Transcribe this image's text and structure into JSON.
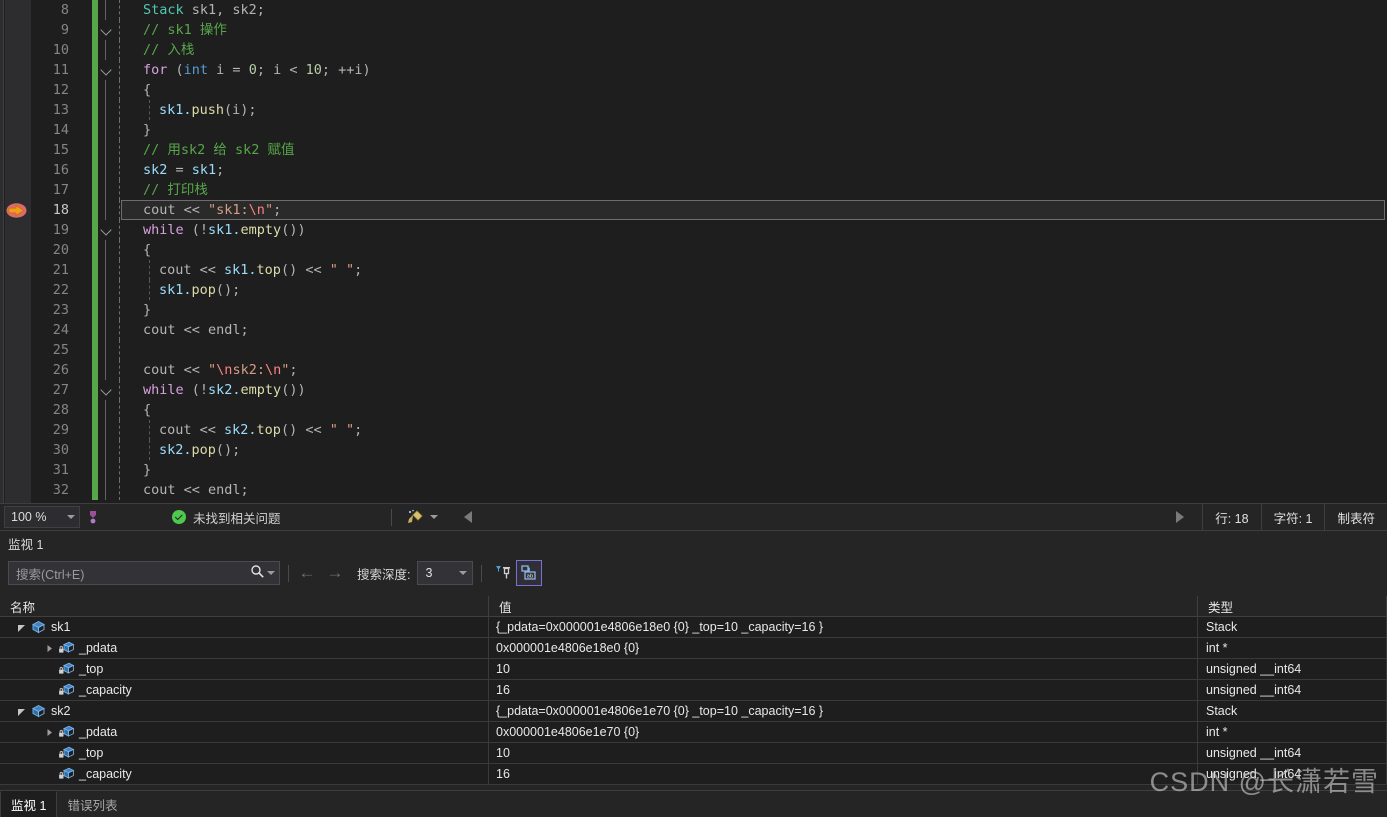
{
  "editor": {
    "lines": [
      {
        "n": "8",
        "chev": false,
        "guide": false,
        "indent": 2,
        "tokens": [
          {
            "t": "Stack",
            "c": "typ"
          },
          {
            "t": " sk1, sk2;",
            "c": "pun"
          }
        ]
      },
      {
        "n": "9",
        "chev": true,
        "guide": false,
        "indent": 2,
        "tokens": [
          {
            "t": "// sk1 操作",
            "c": "cmt"
          }
        ]
      },
      {
        "n": "10",
        "chev": false,
        "guide": false,
        "indent": 2,
        "tokens": [
          {
            "t": "// 入栈",
            "c": "cmt"
          }
        ]
      },
      {
        "n": "11",
        "chev": true,
        "guide": false,
        "indent": 2,
        "tokens": [
          {
            "t": "for",
            "c": "kw"
          },
          {
            "t": " (",
            "c": "pun"
          },
          {
            "t": "int",
            "c": "bt"
          },
          {
            "t": " i = ",
            "c": "pun"
          },
          {
            "t": "0",
            "c": "num"
          },
          {
            "t": "; i < ",
            "c": "pun"
          },
          {
            "t": "10",
            "c": "num"
          },
          {
            "t": "; ++i)",
            "c": "pun"
          }
        ]
      },
      {
        "n": "12",
        "chev": false,
        "guide": false,
        "indent": 2,
        "tokens": [
          {
            "t": "{",
            "c": "pun"
          }
        ]
      },
      {
        "n": "13",
        "chev": false,
        "guide": true,
        "indent": 4,
        "tokens": [
          {
            "t": "sk1.",
            "c": "var"
          },
          {
            "t": "push",
            "c": "fn"
          },
          {
            "t": "(i);",
            "c": "pun"
          }
        ]
      },
      {
        "n": "14",
        "chev": false,
        "guide": false,
        "indent": 2,
        "tokens": [
          {
            "t": "}",
            "c": "pun"
          }
        ]
      },
      {
        "n": "15",
        "chev": false,
        "guide": false,
        "indent": 2,
        "tokens": [
          {
            "t": "// 用sk2 给 sk2 赋值",
            "c": "cmt"
          }
        ]
      },
      {
        "n": "16",
        "chev": false,
        "guide": false,
        "indent": 2,
        "tokens": [
          {
            "t": "sk2",
            "c": "var"
          },
          {
            "t": " = ",
            "c": "pun"
          },
          {
            "t": "sk1",
            "c": "var"
          },
          {
            "t": ";",
            "c": "pun"
          }
        ]
      },
      {
        "n": "17",
        "chev": false,
        "guide": false,
        "indent": 2,
        "tokens": [
          {
            "t": "// 打印栈",
            "c": "cmt"
          }
        ]
      },
      {
        "n": "18",
        "chev": false,
        "guide": false,
        "indent": 2,
        "current": true,
        "tokens": [
          {
            "t": "cout",
            "c": "pun"
          },
          {
            "t": " << ",
            "c": "op"
          },
          {
            "t": "\"sk1:",
            "c": "str"
          },
          {
            "t": "\\n",
            "c": "esc"
          },
          {
            "t": "\"",
            "c": "str"
          },
          {
            "t": ";",
            "c": "pun"
          }
        ]
      },
      {
        "n": "19",
        "chev": true,
        "guide": false,
        "indent": 2,
        "tokens": [
          {
            "t": "while",
            "c": "kw"
          },
          {
            "t": " (!",
            "c": "pun"
          },
          {
            "t": "sk1.",
            "c": "var"
          },
          {
            "t": "empty",
            "c": "fn"
          },
          {
            "t": "())",
            "c": "pun"
          }
        ]
      },
      {
        "n": "20",
        "chev": false,
        "guide": false,
        "indent": 2,
        "tokens": [
          {
            "t": "{",
            "c": "pun"
          }
        ]
      },
      {
        "n": "21",
        "chev": false,
        "guide": true,
        "indent": 4,
        "tokens": [
          {
            "t": "cout",
            "c": "pun"
          },
          {
            "t": " << ",
            "c": "op"
          },
          {
            "t": "sk1.",
            "c": "var"
          },
          {
            "t": "top",
            "c": "fn"
          },
          {
            "t": "()",
            "c": "pun"
          },
          {
            "t": " << ",
            "c": "op"
          },
          {
            "t": "\" \"",
            "c": "str"
          },
          {
            "t": ";",
            "c": "pun"
          }
        ]
      },
      {
        "n": "22",
        "chev": false,
        "guide": true,
        "indent": 4,
        "tokens": [
          {
            "t": "sk1.",
            "c": "var"
          },
          {
            "t": "pop",
            "c": "fn"
          },
          {
            "t": "();",
            "c": "pun"
          }
        ]
      },
      {
        "n": "23",
        "chev": false,
        "guide": false,
        "indent": 2,
        "tokens": [
          {
            "t": "}",
            "c": "pun"
          }
        ]
      },
      {
        "n": "24",
        "chev": false,
        "guide": false,
        "indent": 2,
        "tokens": [
          {
            "t": "cout",
            "c": "pun"
          },
          {
            "t": " << ",
            "c": "op"
          },
          {
            "t": "endl",
            "c": "pun"
          },
          {
            "t": ";",
            "c": "pun"
          }
        ]
      },
      {
        "n": "25",
        "chev": false,
        "guide": false,
        "indent": 2,
        "tokens": []
      },
      {
        "n": "26",
        "chev": false,
        "guide": false,
        "indent": 2,
        "tokens": [
          {
            "t": "cout",
            "c": "pun"
          },
          {
            "t": " << ",
            "c": "op"
          },
          {
            "t": "\"",
            "c": "str"
          },
          {
            "t": "\\n",
            "c": "esc"
          },
          {
            "t": "sk2:",
            "c": "str"
          },
          {
            "t": "\\n",
            "c": "esc"
          },
          {
            "t": "\"",
            "c": "str"
          },
          {
            "t": ";",
            "c": "pun"
          }
        ]
      },
      {
        "n": "27",
        "chev": true,
        "guide": false,
        "indent": 2,
        "tokens": [
          {
            "t": "while",
            "c": "kw"
          },
          {
            "t": " (!",
            "c": "pun"
          },
          {
            "t": "sk2.",
            "c": "var"
          },
          {
            "t": "empty",
            "c": "fn"
          },
          {
            "t": "())",
            "c": "pun"
          }
        ]
      },
      {
        "n": "28",
        "chev": false,
        "guide": false,
        "indent": 2,
        "tokens": [
          {
            "t": "{",
            "c": "pun"
          }
        ]
      },
      {
        "n": "29",
        "chev": false,
        "guide": true,
        "indent": 4,
        "tokens": [
          {
            "t": "cout",
            "c": "pun"
          },
          {
            "t": " << ",
            "c": "op"
          },
          {
            "t": "sk2.",
            "c": "var"
          },
          {
            "t": "top",
            "c": "fn"
          },
          {
            "t": "()",
            "c": "pun"
          },
          {
            "t": " << ",
            "c": "op"
          },
          {
            "t": "\" \"",
            "c": "str"
          },
          {
            "t": ";",
            "c": "pun"
          }
        ]
      },
      {
        "n": "30",
        "chev": false,
        "guide": true,
        "indent": 4,
        "tokens": [
          {
            "t": "sk2.",
            "c": "var"
          },
          {
            "t": "pop",
            "c": "fn"
          },
          {
            "t": "();",
            "c": "pun"
          }
        ]
      },
      {
        "n": "31",
        "chev": false,
        "guide": false,
        "indent": 2,
        "tokens": [
          {
            "t": "}",
            "c": "pun"
          }
        ]
      },
      {
        "n": "32",
        "chev": false,
        "guide": false,
        "indent": 2,
        "tokens": [
          {
            "t": "cout",
            "c": "pun"
          },
          {
            "t": " << ",
            "c": "op"
          },
          {
            "t": "endl",
            "c": "pun"
          },
          {
            "t": ";",
            "c": "pun"
          }
        ]
      }
    ]
  },
  "editor_status": {
    "zoom": "100 %",
    "problems_text": "未找到相关问题",
    "line_label": "行: 18",
    "char_label": "字符: 1",
    "tab_label": "制表符"
  },
  "watch": {
    "title": "监视 1",
    "search_placeholder": "搜索(Ctrl+E)",
    "depth_label": "搜索深度:",
    "depth_value": "3",
    "columns": [
      "名称",
      "值",
      "类型"
    ],
    "rows": [
      {
        "indent": 0,
        "twist": "open",
        "icon": "struct-icon",
        "name": "sk1",
        "value": "{_pdata=0x000001e4806e18e0 {0} _top=10 _capacity=16 }",
        "type": "Stack"
      },
      {
        "indent": 1,
        "twist": "closed",
        "icon": "field-private-icon",
        "name": "_pdata",
        "value": "0x000001e4806e18e0 {0}",
        "type": "int *"
      },
      {
        "indent": 1,
        "twist": "none",
        "icon": "field-private-icon",
        "name": "_top",
        "value": "10",
        "type": "unsigned __int64"
      },
      {
        "indent": 1,
        "twist": "none",
        "icon": "field-private-icon",
        "name": "_capacity",
        "value": "16",
        "type": "unsigned __int64"
      },
      {
        "indent": 0,
        "twist": "open",
        "icon": "struct-icon",
        "name": "sk2",
        "value": "{_pdata=0x000001e4806e1e70 {0} _top=10 _capacity=16 }",
        "type": "Stack"
      },
      {
        "indent": 1,
        "twist": "closed",
        "icon": "field-private-icon",
        "name": "_pdata",
        "value": "0x000001e4806e1e70 {0}",
        "type": "int *"
      },
      {
        "indent": 1,
        "twist": "none",
        "icon": "field-private-icon",
        "name": "_top",
        "value": "10",
        "type": "unsigned __int64"
      },
      {
        "indent": 1,
        "twist": "none",
        "icon": "field-private-icon",
        "name": "_capacity",
        "value": "16",
        "type": "unsigned __int64"
      }
    ],
    "tabs": [
      {
        "label": "监视 1",
        "active": true
      },
      {
        "label": "错误列表",
        "active": false
      }
    ]
  },
  "watermark": "CSDN @长潇若雪",
  "colors": {
    "editor_bg": "#1e1e1e",
    "panel_bg": "#252526",
    "change_bar": "#57a64a",
    "keyword": "#d8a0df",
    "type": "#4ec9b0",
    "builtin_type": "#569cd6",
    "number": "#b5cea8",
    "comment": "#57a64a",
    "string": "#d69d85",
    "escape": "#ff8080",
    "identifier": "#9cdcfe",
    "function": "#dcdcaa",
    "selected_border": "#7a6fd4"
  }
}
